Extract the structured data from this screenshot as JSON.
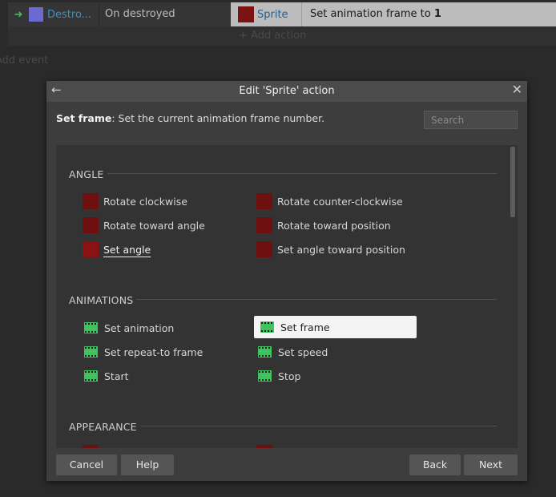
{
  "sheet": {
    "event_object_name": "Destro...",
    "event_condition": "On destroyed",
    "action_object_name": "Sprite",
    "action_text_prefix": "Set animation frame to ",
    "action_text_value": "1",
    "add_action": "+ Add action",
    "add_event": "Add event"
  },
  "dialog": {
    "title": "Edit 'Sprite' action",
    "back_icon": "←",
    "close_icon": "✕",
    "description_bold": "Set frame",
    "description_rest": ": Set the current animation frame number.",
    "search_placeholder": "Search",
    "categories": [
      {
        "name": "ANGLE",
        "items": [
          "Rotate clockwise",
          "Rotate counter-clockwise",
          "Rotate toward angle",
          "Rotate toward position",
          "Set angle",
          "Set angle toward position"
        ]
      },
      {
        "name": "ANIMATIONS",
        "items": [
          "Set animation",
          "Set frame",
          "Set repeat-to frame",
          "Set speed",
          "Start",
          "Stop"
        ]
      },
      {
        "name": "APPEARANCE",
        "items": []
      }
    ],
    "buttons": {
      "cancel": "Cancel",
      "help": "Help",
      "back": "Back",
      "next": "Next"
    }
  },
  "colors": {
    "selection_bg": "#f4f4f4",
    "action_icon": "#6e1010",
    "animation_icon": "#3fc25f",
    "object_link": "#3d8ec4"
  }
}
